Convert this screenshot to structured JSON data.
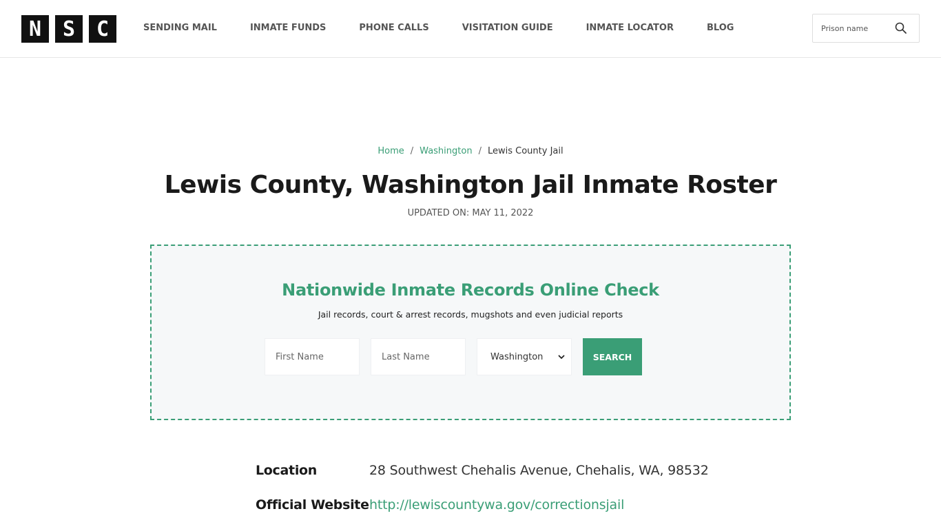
{
  "header": {
    "logo_letters": [
      "N",
      "S",
      "C"
    ],
    "nav": [
      {
        "label": "SENDING MAIL"
      },
      {
        "label": "INMATE FUNDS"
      },
      {
        "label": "PHONE CALLS"
      },
      {
        "label": "VISITATION GUIDE"
      },
      {
        "label": "INMATE LOCATOR"
      },
      {
        "label": "BLOG"
      }
    ],
    "search": {
      "placeholder": "Prison name",
      "icon": "search-icon"
    }
  },
  "breadcrumb": {
    "home": "Home",
    "state": "Washington",
    "current": "Lewis County Jail",
    "separator": "/"
  },
  "page": {
    "title": "Lewis County, Washington Jail Inmate Roster",
    "updated": "UPDATED ON: MAY 11, 2022"
  },
  "records_check": {
    "title": "Nationwide Inmate Records Online Check",
    "subtitle": "Jail records, court & arrest records, mugshots and even judicial reports",
    "first_name_placeholder": "First Name",
    "last_name_placeholder": "Last Name",
    "state_selected": "Washington",
    "search_label": "SEARCH",
    "accent_color": "#3a9e76"
  },
  "info": {
    "location_label": "Location",
    "location_value": "28 Southwest Chehalis Avenue, Chehalis, WA, 98532",
    "website_label": "Official Website",
    "website_value": "http://lewiscountywa.gov/correctionsjail"
  }
}
